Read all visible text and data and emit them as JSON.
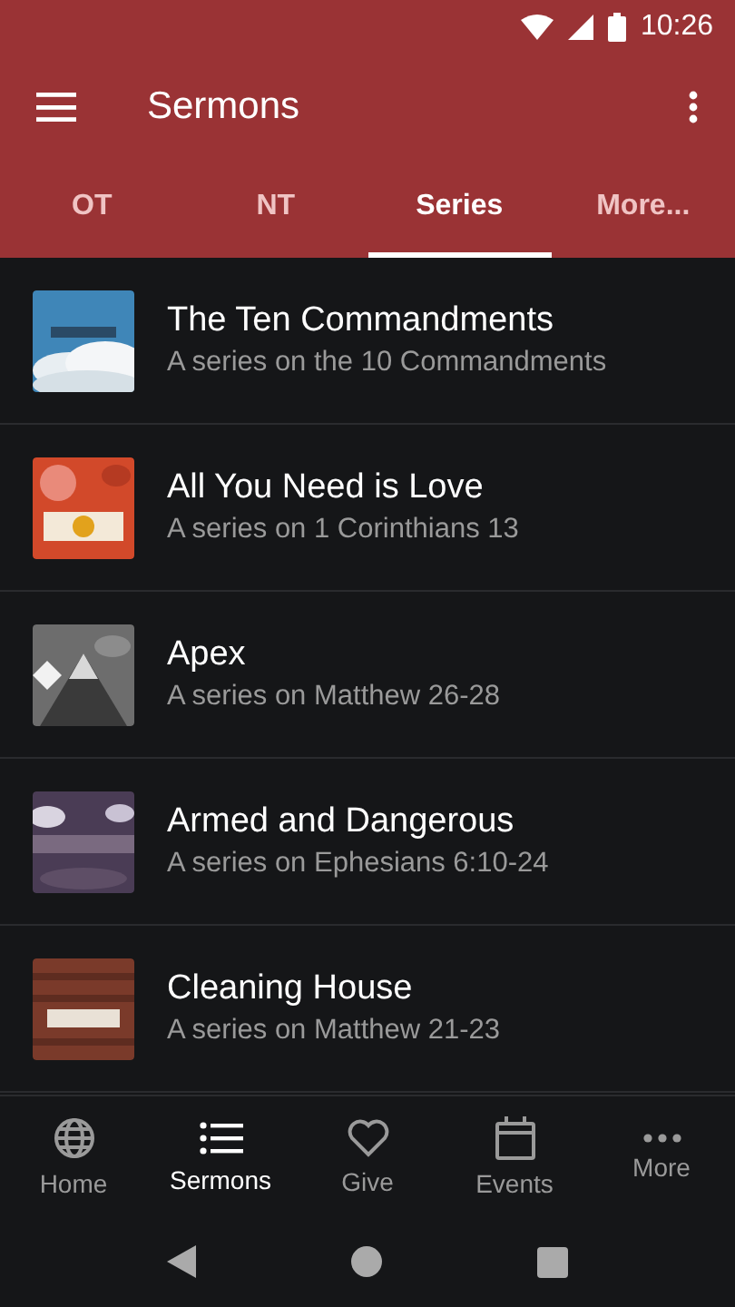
{
  "status_bar": {
    "time": "10:26"
  },
  "toolbar": {
    "title": "Sermons"
  },
  "tabs": [
    {
      "label": "OT",
      "selected": false
    },
    {
      "label": "NT",
      "selected": false
    },
    {
      "label": "Series",
      "selected": true
    },
    {
      "label": "More...",
      "selected": false
    }
  ],
  "series": [
    {
      "title": "The Ten Commandments",
      "subtitle": "A series on the 10 Commandments",
      "kind": "picture"
    },
    {
      "title": "All You Need is Love",
      "subtitle": "A series on 1 Corinthians 13",
      "kind": "picture"
    },
    {
      "title": "Apex",
      "subtitle": "A series on Matthew 26-28",
      "kind": "picture"
    },
    {
      "title": "Armed and Dangerous",
      "subtitle": "A series on Ephesians 6:10-24",
      "kind": "picture"
    },
    {
      "title": "Cleaning House",
      "subtitle": "A series on Matthew 21-23",
      "kind": "picture"
    }
  ],
  "bottom_nav": [
    {
      "label": "Home",
      "kind": "globe",
      "selected": false
    },
    {
      "label": "Sermons",
      "kind": "list",
      "selected": true
    },
    {
      "label": "Give",
      "kind": "heart",
      "selected": false
    },
    {
      "label": "Events",
      "kind": "calendar",
      "selected": false
    },
    {
      "label": "More",
      "kind": "dots",
      "selected": false
    }
  ]
}
